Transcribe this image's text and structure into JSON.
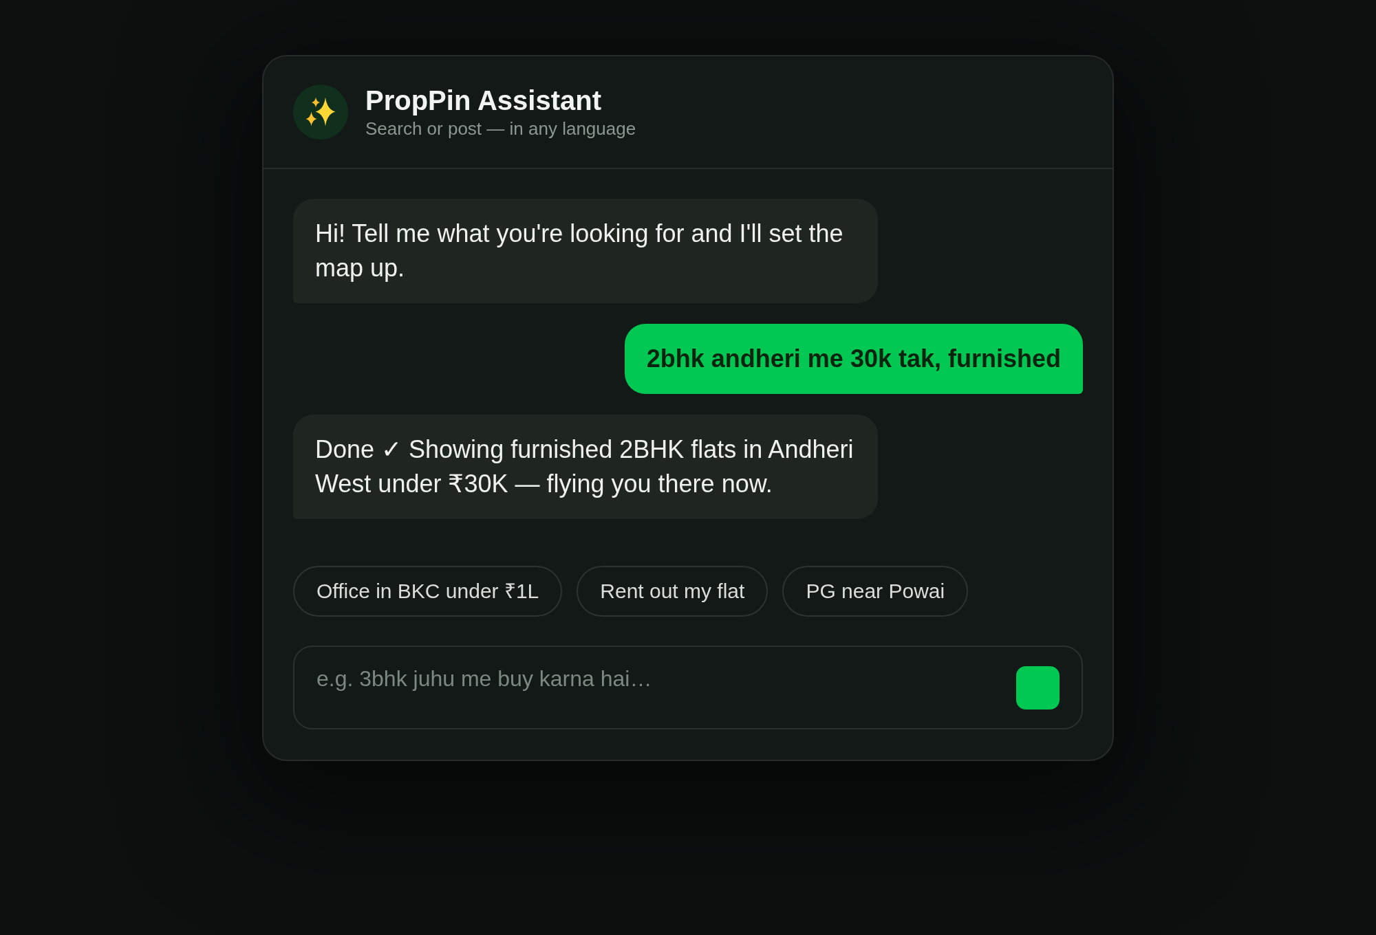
{
  "header": {
    "title": "PropPin Assistant",
    "subtitle": "Search or post — in any language"
  },
  "messages": [
    {
      "kind": "assistant",
      "text": "Hi! Tell me what you're looking for and I'll set the map up."
    },
    {
      "kind": "user",
      "text": "2bhk andheri me 30k tak, furnished"
    },
    {
      "kind": "assistant",
      "text": "Done ✓ Showing furnished 2BHK flats in Andheri West under ₹30K — flying you there now."
    }
  ],
  "suggestions": [
    "Office in BKC under ₹1L",
    "Rent out my flat",
    "PG near Powai"
  ],
  "composer": {
    "placeholder": "e.g. 3bhk juhu me buy karna hai…"
  }
}
